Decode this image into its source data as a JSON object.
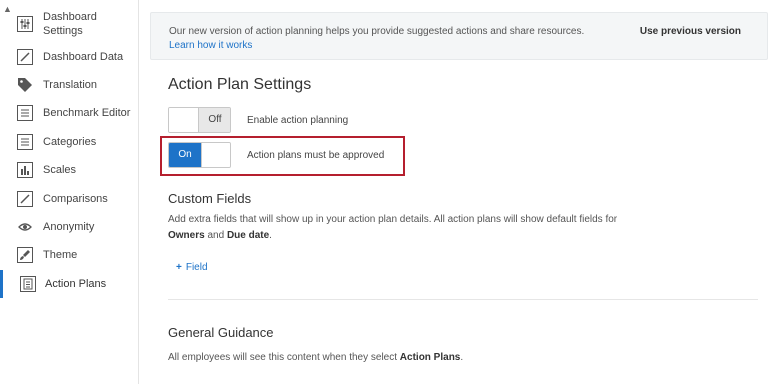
{
  "sidebar": {
    "items": [
      {
        "label": "Dashboard Settings",
        "icon": "sliders-icon"
      },
      {
        "label": "Dashboard Data",
        "icon": "pencil-icon"
      },
      {
        "label": "Translation",
        "icon": "tag-icon"
      },
      {
        "label": "Benchmark Editor",
        "icon": "list-icon"
      },
      {
        "label": "Categories",
        "icon": "list-icon"
      },
      {
        "label": "Scales",
        "icon": "bar-chart-icon"
      },
      {
        "label": "Comparisons",
        "icon": "pencil-icon"
      },
      {
        "label": "Anonymity",
        "icon": "eye-icon"
      },
      {
        "label": "Theme",
        "icon": "brush-icon"
      },
      {
        "label": "Action Plans",
        "icon": "clipboard-icon"
      }
    ],
    "active_index": 9
  },
  "banner": {
    "text": "Our new version of action planning helps you provide suggested actions and share resources.",
    "link": "Learn how it works",
    "button": "Use previous version"
  },
  "settings": {
    "title": "Action Plan Settings",
    "toggle1": {
      "state_label": "Off",
      "label": "Enable action planning"
    },
    "toggle2": {
      "state_label": "On",
      "label": "Action plans must be approved"
    }
  },
  "custom_fields": {
    "title": "Custom Fields",
    "desc_prefix": "Add extra fields that will show up in your action plan details. All action plans will show default fields for ",
    "desc_owners": "Owners",
    "desc_and": " and ",
    "desc_due": "Due date",
    "desc_end": ".",
    "add_button": "Field"
  },
  "guidance": {
    "title": "General Guidance",
    "desc_prefix": "All employees will see this content when they select ",
    "desc_bold": "Action Plans",
    "desc_end": "."
  },
  "colors": {
    "accent": "#1e73c8",
    "highlight": "#b51f2e"
  }
}
